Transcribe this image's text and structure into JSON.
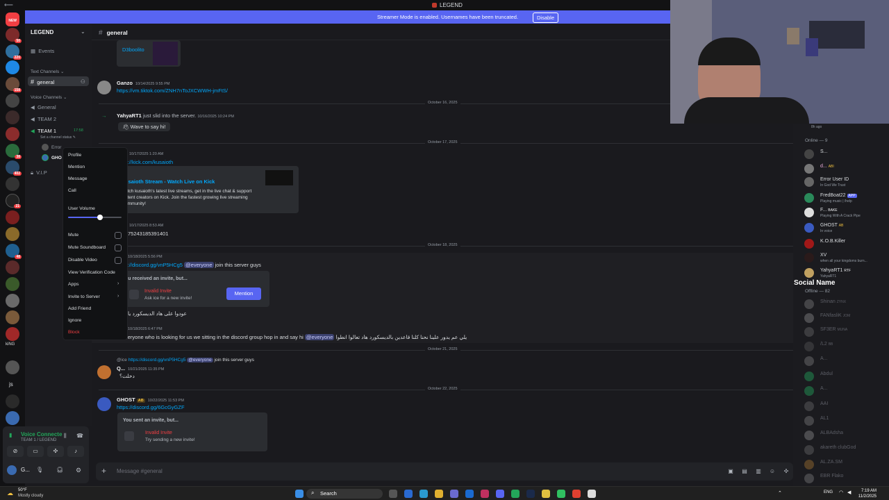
{
  "window": {
    "title": "LEGEND"
  },
  "banner": {
    "message": "Streamer Mode is enabled. Usernames have been truncated.",
    "disable_label": "Disable"
  },
  "rail": {
    "badges": [
      "NEW",
      "50",
      "220",
      "158",
      "38",
      "402",
      "21",
      "48"
    ],
    "texts": [
      "kiNG",
      "js"
    ]
  },
  "sidebar": {
    "guild_name": "LEGEND",
    "events": "Events",
    "text_category": "Text Channels",
    "general": "general",
    "voice_category": "Voice Channels",
    "voice_general": "General",
    "team2": "TEAM 2",
    "team1": "TEAM 1",
    "team1_time": "17:58",
    "status_hint": "Set a channel status",
    "member1": "Error",
    "member2": "GHO",
    "vip": "V.I.P"
  },
  "voice_panel": {
    "title": "Voice Connecte",
    "subtitle": "TEAM 1 / LEGEND",
    "user": "G..."
  },
  "chat_header": {
    "channel": "general"
  },
  "messages": {
    "d3boolito": "D3boolito",
    "ganzo_name": "Ganzo",
    "ganzo_ts": "10/14/2025 9:55 PM",
    "ganzo_link": "https://vm.tiktok.com/ZNH7nToJXCWWH-jmFtS/",
    "date1": "October 16, 2025",
    "yahya_name": "YahyaRT1",
    "yahya_text": "just slid into the server.",
    "yahya_ts": "10/16/2025 10:24 PM",
    "wave": "Wave to say hi!",
    "date2": "October 17, 2025",
    "k_ts": "10/17/2025 1:20 AM",
    "k_link": "s://kick.com/kusaioth",
    "embed_title": "usaioth Stream - Watch Live on Kick",
    "embed_desc1": "atch kusaioth's latest live streams, get in the live chat & support",
    "embed_desc2": "ntent creators on Kick. Join the fastest growing live streaming",
    "embed_desc3": "ommunity!",
    "n_ts": "10/17/2025 8:53 AM",
    "n_text": "7524318539140​1",
    "date3": "October 18, 2025",
    "d_ts": "10/18/2025 5:56 PM",
    "d_link": "s://discord.gg/vnP5HCg5",
    "everyone": "@everyone",
    "d_text": "join this server guys",
    "inv1_label": "ou received an invite, but...",
    "inv1_red": "Invalid Invite",
    "inv1_sub": "Ask ice for a new invite!",
    "mention_btn": "Mention",
    "ar1": "عودوا على هاد الديسكورد يا",
    "e_ts": "10/18/2025 6:47 PM",
    "e_text": "veryone who is looking for us we sitting in the discord group hop in and say hi",
    "e_ar": "يلي عم يدور علينا نحنا كلنا قاعدين بالديسكورد هاد تعالوا انطوا",
    "date4": "October 21, 2025",
    "q_reply": "@ice",
    "q_reply_link": "https://discord.gg/vnP5HCg5",
    "q_reply_text": "join this server guys",
    "q_name": "Q...",
    "q_ts": "10/21/2025 11:35 PM",
    "q_text": "دخلت؟",
    "date5": "October 22, 2025",
    "g_name": "GHOST",
    "g_tag": "AB",
    "g_ts": "10/22/2025 11:53 PM",
    "g_link": "https://discord.gg/6GcGyGZF",
    "inv2_label": "You sent an invite, but...",
    "inv2_red": "Invalid Invite",
    "inv2_sub": "Try sending a new invite!"
  },
  "context_menu": {
    "profile": "Profile",
    "mention": "Mention",
    "message": "Message",
    "call": "Call",
    "user_volume": "User Volume",
    "volume_level": 0.6,
    "mute": "Mute",
    "mute_soundboard": "Mute Soundboard",
    "disable_video": "Disable Video",
    "view_code": "View Verification Code",
    "apps": "Apps",
    "invite": "Invite to Server",
    "add_friend": "Add Friend",
    "ignore": "Ignore",
    "block": "Block"
  },
  "members": {
    "top_status": "8h ago",
    "online": "Online — 9",
    "m1": "S...",
    "m2": "d...",
    "m2_tag": "ABI",
    "m3": "Error User ID",
    "m3_s": "In God We Trust",
    "m4": "FredBoat22",
    "m4_tag": "APP",
    "m4_s": "Playing music | /help",
    "m5": "F...",
    "m5_tag": "BAKE",
    "m5_s": "Playing With A Crack Pipe",
    "m6": "GHOST",
    "m6_tag": "AB",
    "m6_s": "In voice",
    "m7": "K.O.B.Killer",
    "m8": "XV",
    "m8_s": "when all your kingdoms burn...",
    "m9": "YahyaRT1",
    "m9_tag": "RTF",
    "m9_s": "YahyaRT1",
    "overlay": "Social Name",
    "offline": "Offline — 82",
    "off": [
      "Shinan",
      "FANfasliK",
      "SF3ER",
      "/L2",
      "A...",
      "Abdul",
      "A...",
      "AAI",
      "AL1",
      "ALBAdsha",
      "akareth clubGod",
      "AL.ZA.SM",
      "EBR Flako"
    ],
    "off_tags": [
      "ZYNX",
      "JOM",
      "MUNA",
      "BB"
    ]
  },
  "composer": {
    "placeholder": "Message #general"
  },
  "taskbar": {
    "weather_temp": "50°F",
    "weather_desc": "Mostly cloudy",
    "search": "Search",
    "lang": "ENG",
    "time": "7:19 AM",
    "date": "11/2/2025"
  }
}
